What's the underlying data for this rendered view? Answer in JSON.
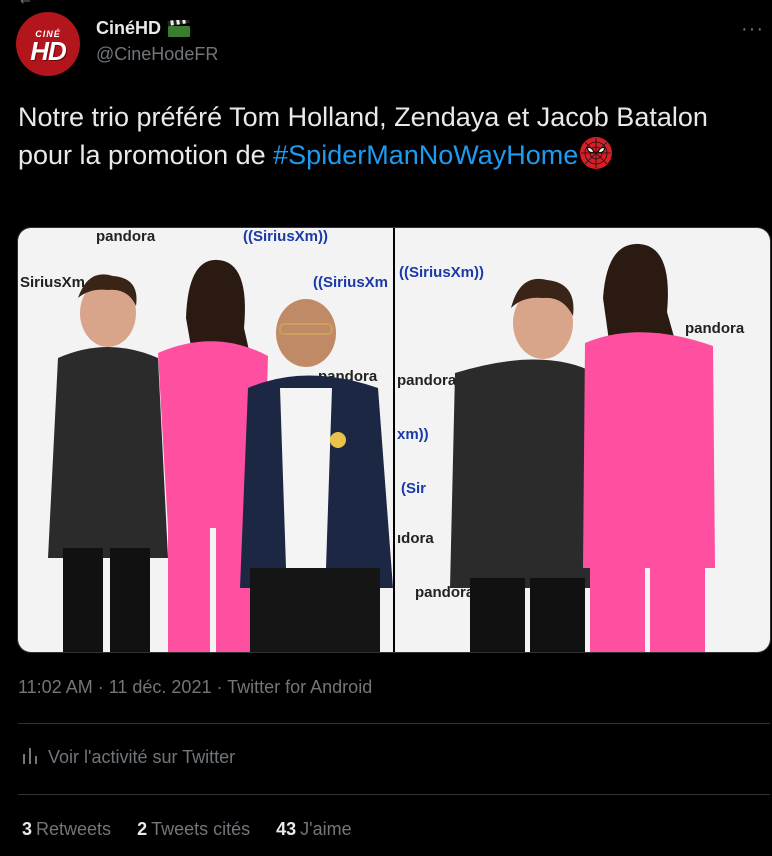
{
  "account": {
    "name": "CinéHD",
    "handle": "@CineHodeFR",
    "avatar_line1": "CINÉ",
    "avatar_line2": "HD"
  },
  "tweet": {
    "text_line": "Notre trio préféré Tom Holland, Zendaya et Jacob Batalon pour la promotion de ",
    "hashtag": "#SpiderManNoWayHome"
  },
  "photos": {
    "left_brands": [
      "pandora",
      "((SiriusXm))",
      "SiriusXm",
      "((SiriusXm",
      "pandora"
    ],
    "right_brands": [
      "((SiriusXm))",
      "pandora",
      "pandora",
      "ıdora",
      "pandora",
      "xm))",
      "(Sir"
    ]
  },
  "meta": {
    "timestamp": "11:02 AM · 11 déc. 2021 · Twitter for Android"
  },
  "activity": {
    "label": "Voir l'activité sur Twitter"
  },
  "stats": {
    "retweets_count": "3",
    "retweets_label": "Retweets",
    "quotes_count": "2",
    "quotes_label": "Tweets cités",
    "likes_count": "43",
    "likes_label": "J'aime"
  },
  "colors": {
    "background": "#000000",
    "hashtag": "#1d9bf0",
    "muted": "#71767b",
    "text": "#e7e9ea",
    "suit_pink": "#ff4fa0"
  }
}
